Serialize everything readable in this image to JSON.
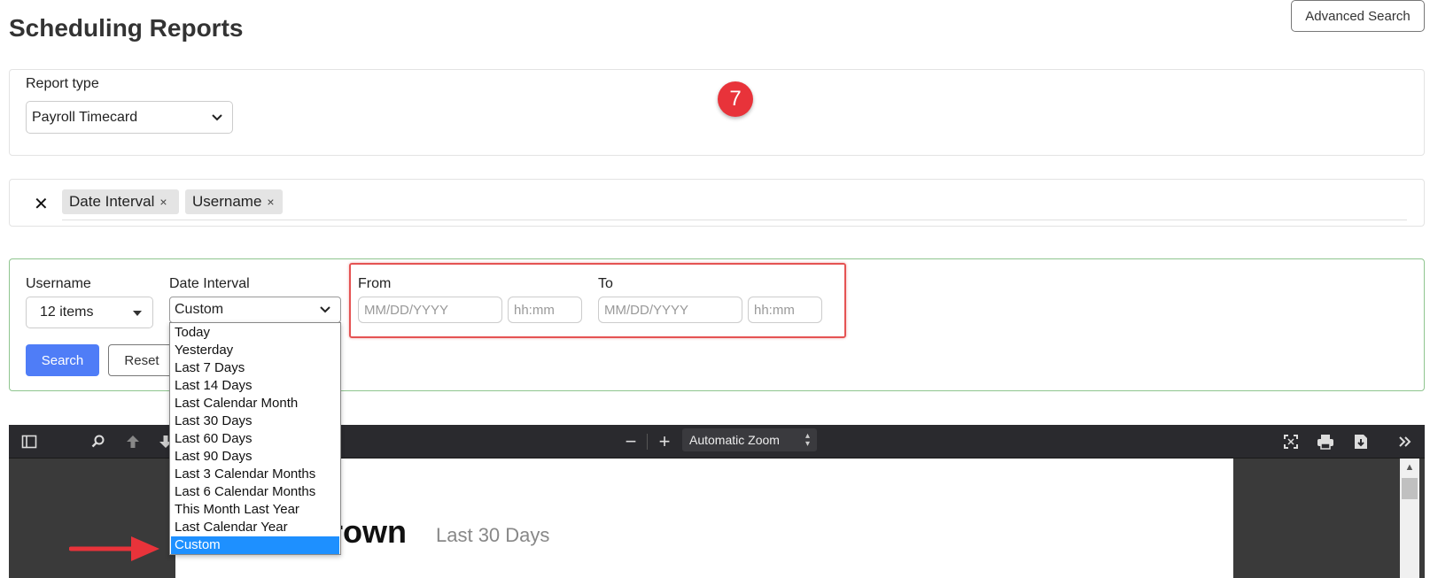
{
  "header": {
    "title": "Scheduling Reports",
    "advanced_search_label": "Advanced Search"
  },
  "report_type": {
    "label": "Report type",
    "value": "Payroll Timecard"
  },
  "step_badge": "7",
  "filters": {
    "clear_symbol": "✕",
    "chips": [
      {
        "label": "Date Interval",
        "remove": "×"
      },
      {
        "label": "Username",
        "remove": "×"
      }
    ]
  },
  "form": {
    "username": {
      "label": "Username",
      "value": "12 items"
    },
    "date_interval": {
      "label": "Date Interval",
      "value": "Custom",
      "options": [
        "Today",
        "Yesterday",
        "Last 7 Days",
        "Last 14 Days",
        "Last Calendar Month",
        "Last 30 Days",
        "Last 60 Days",
        "Last 90 Days",
        "Last 3 Calendar Months",
        "Last 6 Calendar Months",
        "This Month Last Year",
        "Last Calendar Year",
        "Custom"
      ],
      "selected_index": 12
    },
    "from": {
      "label": "From",
      "date_placeholder": "MM/DD/YYYY",
      "time_placeholder": "hh:mm"
    },
    "to": {
      "label": "To",
      "date_placeholder": "MM/DD/YYYY",
      "time_placeholder": "hh:mm"
    },
    "search_label": "Search",
    "reset_label": "Reset"
  },
  "viewer": {
    "zoom_label": "Automatic Zoom",
    "zoom_out": "−",
    "zoom_in": "+",
    "page_heading": "rown",
    "page_subtitle": "Last 30 Days"
  },
  "colors": {
    "primary": "#4f7df7",
    "badge": "#e8333a",
    "highlight": "#e55353",
    "selected_option": "#1e90ff",
    "form_border": "#8fc58f"
  }
}
